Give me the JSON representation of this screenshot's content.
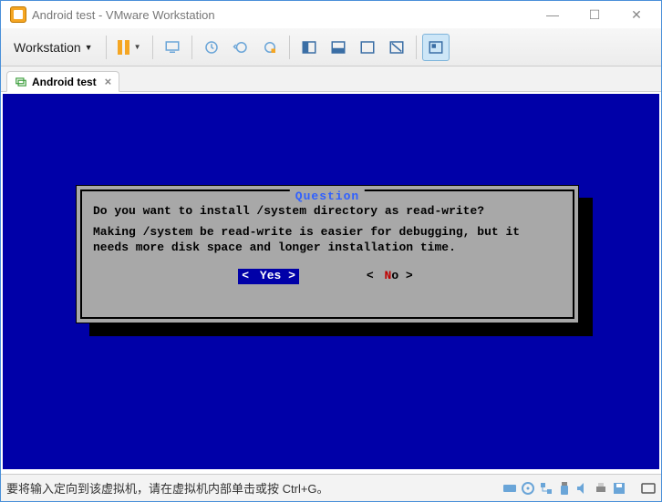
{
  "window": {
    "title": "Android test - VMware Workstation"
  },
  "menu": {
    "workstation": "Workstation"
  },
  "tab": {
    "label": "Android test"
  },
  "dialog": {
    "title": "Question",
    "line1": "Do you want to install /system directory as read-write?",
    "line2": "Making /system be read-write is easier for debugging, but it needs more disk space and longer installation time.",
    "yes_pre": "< ",
    "yes_hot": "Y",
    "yes_rest": "es >",
    "no_pre": "<  ",
    "no_hot": "N",
    "no_rest": "o  >"
  },
  "status": {
    "message": "要将输入定向到该虚拟机，请在虚拟机内部单击或按 Ctrl+G。"
  },
  "colors": {
    "console_bg": "#0000a8",
    "dialog_bg": "#a8a8a8",
    "accent": "#f5a623"
  }
}
